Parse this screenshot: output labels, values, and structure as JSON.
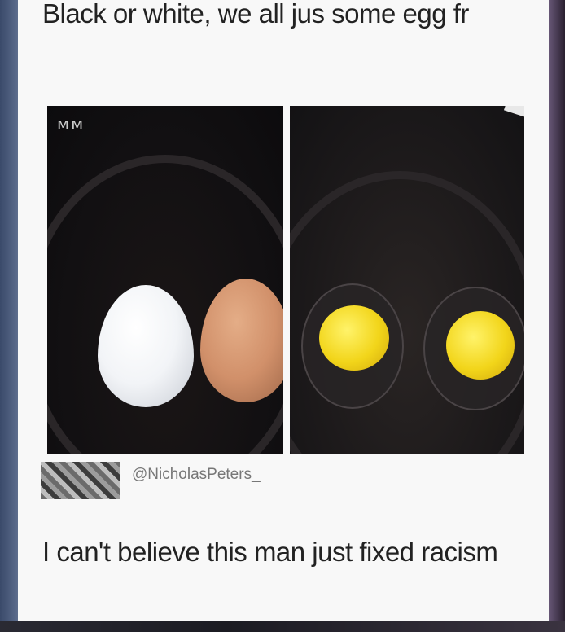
{
  "post": {
    "top_caption": "Black or white, we all jus some egg fr",
    "bottom_caption": "I can't believe this man just fixed racism",
    "image_mark": "ᴍᴍ",
    "attribution_handle": "@NicholasPeters_"
  }
}
